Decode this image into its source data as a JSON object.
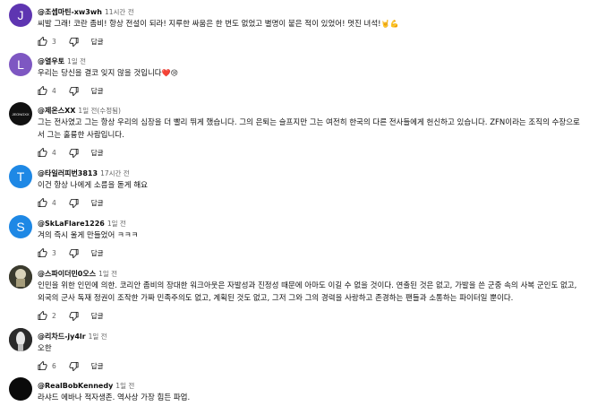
{
  "actions": {
    "reply_label": "답글"
  },
  "comments": [
    {
      "avatar": {
        "letter": "J",
        "color": "#5e35b1"
      },
      "handle": "@조셉마틴-xw3wh",
      "time": "11시간 전",
      "text": "씨발 그래! 코란 좀비! 항상 전설이 되라! 지루한 싸움은 한 번도 없었고 별명이 붙은 적이 있었어! 멋진 녀석!",
      "emoji": "🤘💪",
      "likes": "3"
    },
    {
      "avatar": {
        "letter": "L",
        "color": "#7e57c2"
      },
      "handle": "@열우토",
      "time": "1일 전",
      "text": "우리는 당신을 결코 잊지 않을 것입니다",
      "emoji": "❤️😢",
      "likes": "4"
    },
    {
      "avatar": {
        "letter": "JEONGXX",
        "color": "#111111"
      },
      "handle": "@제온스XX",
      "time": "1일 전(수정됨)",
      "text": "그는 전사였고 그는 항상 우리의 심장을 더 빨리 뛰게 했습니다. 그의 은퇴는 슬프지만 그는 여전히 한국의 다른 전사들에게 헌신하고 있습니다. ZFN이라는 조직의 수장으로서 그는 훌륭한 사람입니다.",
      "emoji": "",
      "likes": "4"
    },
    {
      "avatar": {
        "letter": "T",
        "color": "#1e88e5"
      },
      "handle": "@타일러피번3813",
      "time": "17시간 전",
      "text": "이건 항상 나에게 소름을 돋게 해요",
      "emoji": "",
      "likes": "4"
    },
    {
      "avatar": {
        "letter": "S",
        "color": "#1e88e5"
      },
      "handle": "@SkLaFlare1226",
      "time": "1일 전",
      "text": "겨의 즉시 울게 만들었어 ㅋㅋㅋ",
      "emoji": "",
      "likes": "3"
    },
    {
      "avatar": {
        "letter": "",
        "color": "#3b3b2e"
      },
      "handle": "@스파이더민0오스",
      "time": "1일 전",
      "text": "인민을 위한 인민에 의한. 코리안 좀비의 장대한 워크아웃은 자발성과 진정성 때문에 아마도 이길 수 없을 것이다. 연출된 것은 없고, 가발을 쓴 군중 속의 사복 군인도 없고, 외국의 군사 독재 정권이 조작한 가짜 민족주의도 없고, 계획된 것도 없고, 그저 그와 그의 경력을 사랑하고 존경하는 팬들과 소통하는 파이터일 뿐이다.",
      "emoji": "",
      "likes": "2"
    },
    {
      "avatar": {
        "letter": "",
        "color": "#2a2a2a"
      },
      "handle": "@리차드-jy4lr",
      "time": "1일 전",
      "text": "오한",
      "emoji": "",
      "likes": "6"
    },
    {
      "avatar": {
        "letter": "",
        "color": "#0a0a0a"
      },
      "handle": "@RealBobKennedy",
      "time": "1일 전",
      "text": "라샤드 에바나 적자생존. 역사상 가장 힘든 파업.",
      "emoji": "",
      "likes": ""
    }
  ]
}
